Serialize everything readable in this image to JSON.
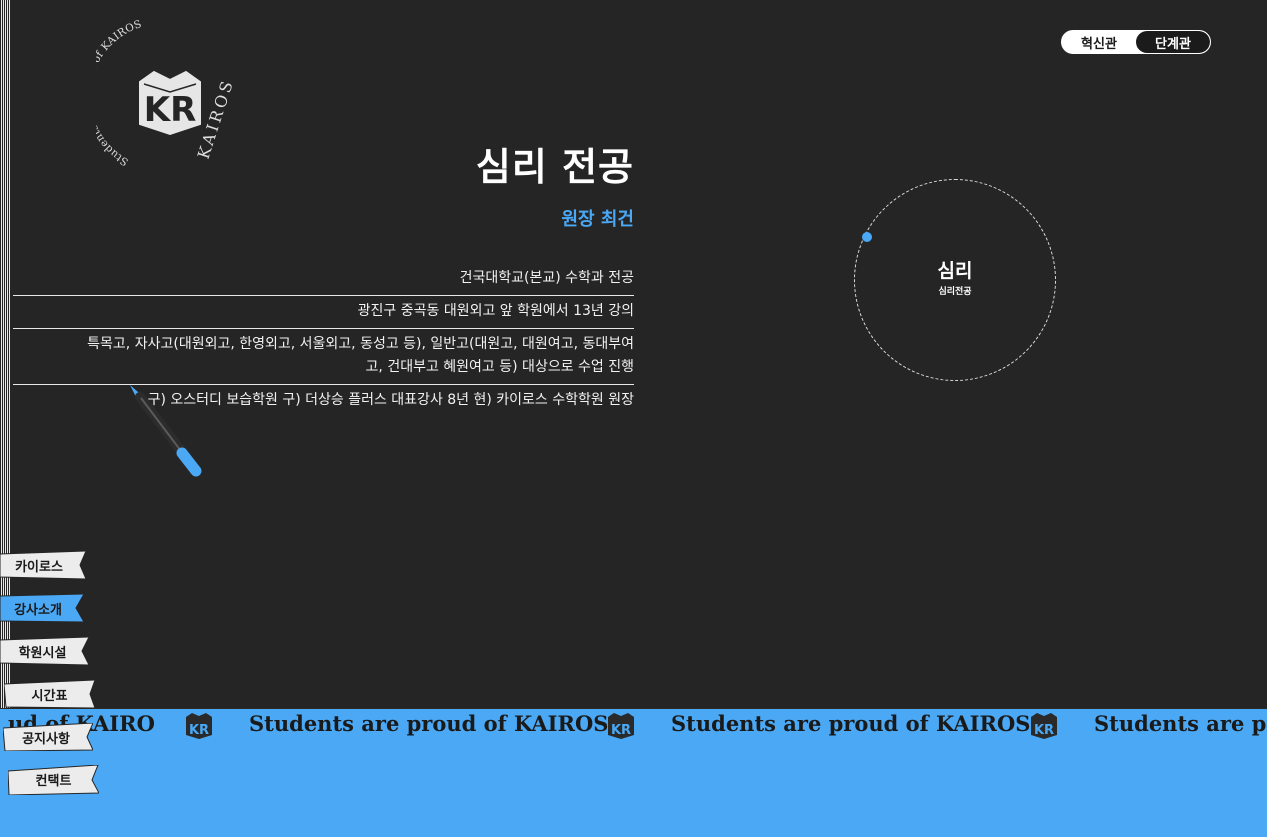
{
  "logo": {
    "arc_text": "Students are proud of KAIROS",
    "brand_text": "KAIROS",
    "mark": "KR"
  },
  "toggle": {
    "option_a": "혁신관",
    "option_b": "단계관"
  },
  "profile": {
    "title": "심리 전공",
    "name": "원장 최건",
    "career": [
      "건국대학교(본교) 수학과 전공",
      "광진구 중곡동 대원외고 앞 학원에서 13년 강의",
      "특목고, 자사고(대원외고, 한영외고, 서울외고, 동성고 등), 일반고(대원고, 대원여고, 동대부여고, 건대부고 혜원여고 등) 대상으로 수업 진행",
      "구) 오스터디 보습학원 구) 더상승 플러스 대표강사 8년 현) 카이로스 수학학원 원장"
    ]
  },
  "orbit": {
    "label": "심리",
    "sublabel": "심리전공"
  },
  "ticker": {
    "fragment": "ud of KAIRO",
    "text": "Students are proud of KAIROS",
    "mark": "KR"
  },
  "nav": [
    {
      "label": "카이로스",
      "active": false
    },
    {
      "label": "강사소개",
      "active": true
    },
    {
      "label": "학원시설",
      "active": false
    },
    {
      "label": "시간표",
      "active": false
    },
    {
      "label": "공지사항",
      "active": false
    },
    {
      "label": "컨택트",
      "active": false
    }
  ],
  "colors": {
    "background": "#252525",
    "accent": "#4aa8f5",
    "text": "#ffffff"
  }
}
